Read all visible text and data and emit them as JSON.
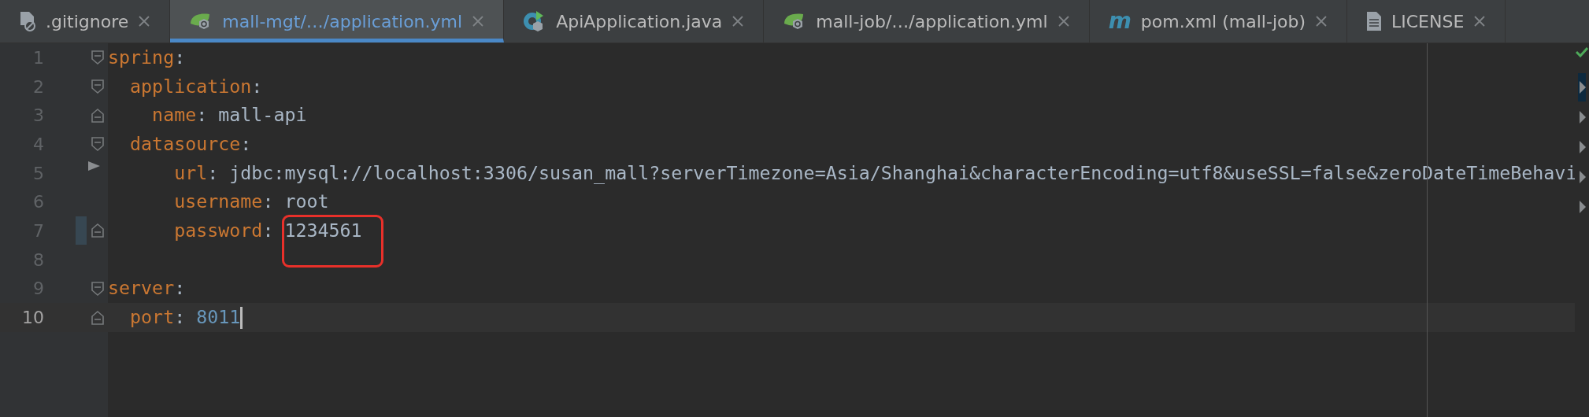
{
  "tabs": [
    {
      "label": ".gitignore",
      "kind": "ignore",
      "selected": false
    },
    {
      "label": "mall-mgt/…/application.yml",
      "kind": "spring",
      "selected": true
    },
    {
      "label": "ApiApplication.java",
      "kind": "java",
      "selected": false
    },
    {
      "label": "mall-job/…/application.yml",
      "kind": "spring",
      "selected": false
    },
    {
      "label": "pom.xml (mall-job)",
      "kind": "maven",
      "glyph": "m",
      "selected": false
    },
    {
      "label": "LICENSE",
      "kind": "text",
      "selected": false
    }
  ],
  "editor": {
    "inspection_ok": true,
    "lines": [
      {
        "number": "1",
        "key": "spring",
        "colon": ":",
        "current": false,
        "children": [
          {
            "number": "2",
            "key": "  application",
            "colon": ":",
            "current": false,
            "children": [
              {
                "number": "3",
                "key": "    name",
                "colon": ":",
                "value": "mall-api",
                "kind": "string",
                "current": false
              }
            ]
          },
          {
            "number": "4",
            "key": "  datasource",
            "colon": ":",
            "current": false,
            "children": [
              {
                "number": "5",
                "key": "      url",
                "colon": ":",
                "value": "jdbc:mysql://localhost:3306/susan_mall?serverTimezone=Asia/Shanghai&characterEncoding=utf8&useSSL=false&zeroDateTimeBehavi",
                "kind": "string",
                "gutter_arrow": true,
                "current": false
              },
              {
                "number": "6",
                "key": "      username",
                "colon": ":",
                "value": "root",
                "kind": "string",
                "current": false
              },
              {
                "number": "7",
                "key": "      password",
                "colon": ":",
                "value": "1234561",
                "kind": "string",
                "boxed": true,
                "changed": true,
                "current": false
              }
            ]
          }
        ]
      },
      {
        "number": "8",
        "current": false
      },
      {
        "number": "9",
        "key": "server",
        "colon": ":",
        "current": false,
        "children": [
          {
            "number": "10",
            "key": "  port",
            "colon": ":",
            "value": "8011",
            "kind": "number",
            "current": true
          }
        ]
      }
    ]
  }
}
